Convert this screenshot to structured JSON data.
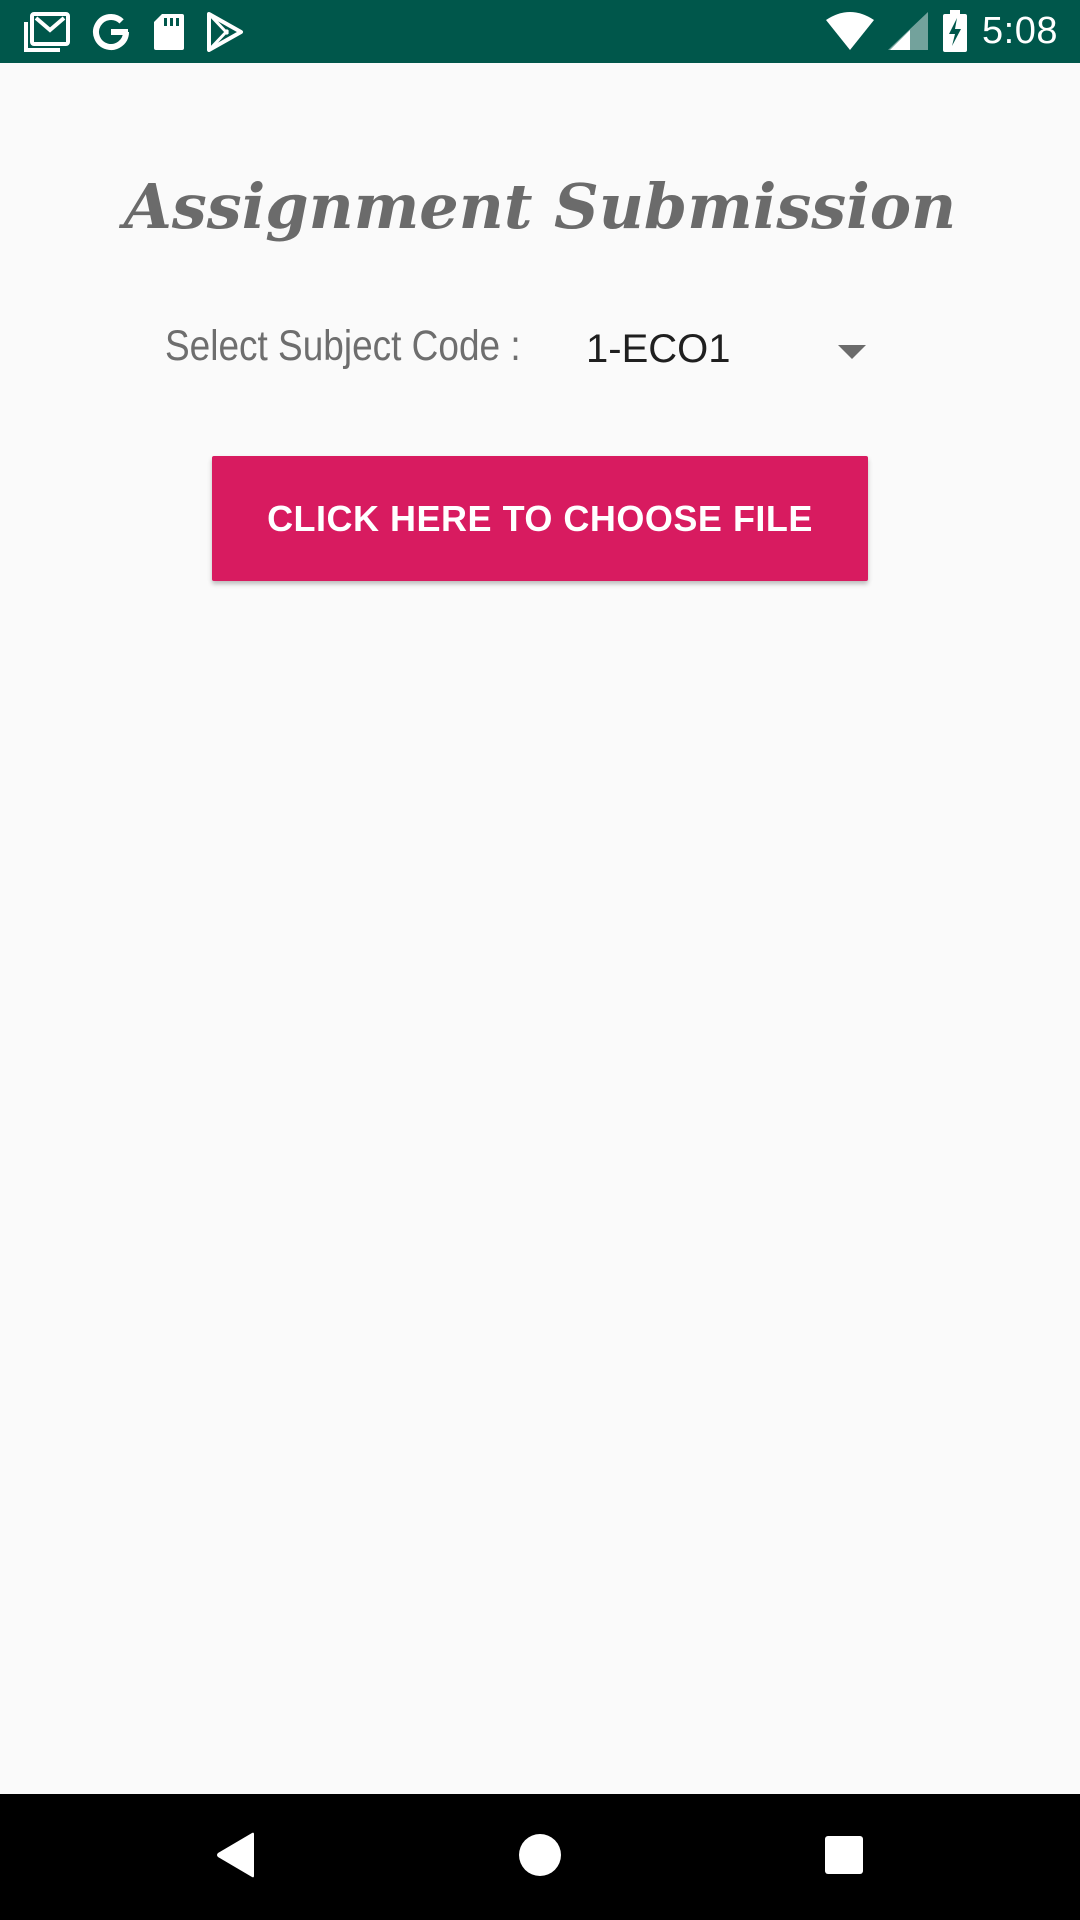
{
  "status_bar": {
    "background": "#00574b",
    "time": "5:08",
    "left_icons": [
      "gmail-icon",
      "google-icon",
      "sd-card-icon",
      "play-store-icon"
    ],
    "right_icons": [
      "wifi-icon",
      "cell-signal-icon",
      "battery-charging-icon"
    ]
  },
  "page": {
    "title": "Assignment Submission",
    "subject_label": "Select Subject Code :",
    "subject_value": "1-ECO1",
    "choose_button_label": "CLICK HERE TO CHOOSE FILE",
    "accent_color": "#d81b60"
  },
  "nav_bar": {
    "icons": [
      "back-icon",
      "home-icon",
      "recents-icon"
    ]
  }
}
